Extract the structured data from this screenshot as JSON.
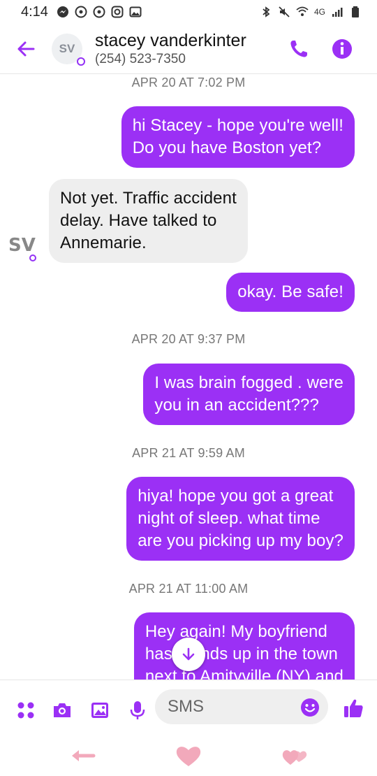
{
  "status_bar": {
    "time": "4:14",
    "network": "4G"
  },
  "header": {
    "avatar_initials": "SV",
    "contact_name": "stacey vanderkinter",
    "contact_phone": "(254) 523-7350"
  },
  "conversation": {
    "timestamps": [
      "APR 20 AT 7:02 PM",
      "APR 20 AT 9:37 PM",
      "APR 21 AT 9:59 AM",
      "APR 21 AT 11:00 AM"
    ],
    "messages": [
      {
        "direction": "outgoing",
        "lines": [
          "hi Stacey - hope you're well!",
          "Do you have Boston yet?"
        ]
      },
      {
        "direction": "incoming",
        "lines": [
          "Not yet.  Traffic accident",
          "delay.  Have talked to",
          "Annemarie."
        ]
      },
      {
        "direction": "outgoing",
        "lines": [
          "okay. Be safe!"
        ]
      },
      {
        "direction": "outgoing",
        "lines": [
          "I was brain fogged . were",
          "you in an accident???"
        ]
      },
      {
        "direction": "outgoing",
        "lines": [
          "hiya! hope you got a great",
          "night of sleep. what time",
          "are you picking up my boy?"
        ]
      },
      {
        "direction": "outgoing",
        "lines": [
          "Hey again! My boyfriend",
          "has friends up in the town",
          "next to Amityville (NY) and"
        ]
      }
    ],
    "incoming_avatar_initials": "SV"
  },
  "composer": {
    "placeholder": "SMS"
  },
  "colors": {
    "accent": "#9b30f5",
    "incoming_bubble": "#eeeeee",
    "nav_pink": "#f2a9bb"
  },
  "icons": {
    "header": [
      "back-arrow-icon",
      "phone-icon",
      "info-icon"
    ],
    "composer": [
      "apps-icon",
      "camera-icon",
      "gallery-icon",
      "microphone-icon",
      "emoji-icon",
      "thumbs-up-icon"
    ],
    "nav": [
      "nav-back-icon",
      "nav-home-icon",
      "nav-recents-icon"
    ]
  }
}
